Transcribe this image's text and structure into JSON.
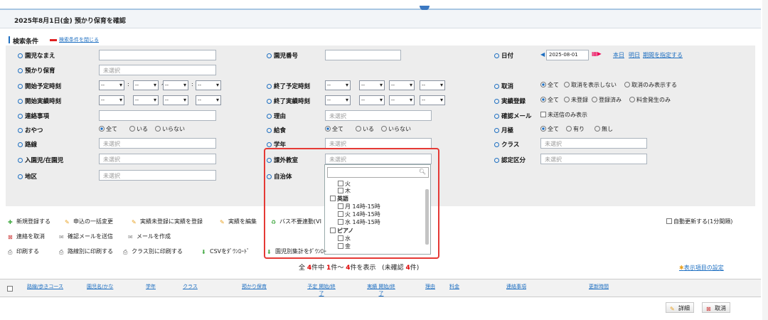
{
  "header": {
    "title": "2025年8月1日(金)  預かり保育を確認"
  },
  "conditions": {
    "title": "検索条件",
    "close_link": "検索条件を閉じる"
  },
  "fields": {
    "child_name": "園児なまえ",
    "child_number": "園児番号",
    "date": "日付",
    "date_value": "2025-08-01",
    "today": "本日",
    "tomorrow": "明日",
    "specify_period": "期間を指定する",
    "care": "預かり保育",
    "unselected": "未選択",
    "start_plan": "開始予定時刻",
    "end_plan": "終了予定時刻",
    "cancel": "取消",
    "cancel_opts": [
      "全て",
      "取消を表示しない",
      "取消のみ表示する"
    ],
    "start_actual": "開始実績時刻",
    "end_actual": "終了実績時刻",
    "actual_reg": "実績登録",
    "actual_opts": [
      "全て",
      "未登録",
      "登録済み",
      "料金発生のみ"
    ],
    "contact": "連絡事項",
    "reason": "理由",
    "confirm_mail": "確認メール",
    "unsent_only": "未送信のみ表示",
    "snack": "おやつ",
    "snack_opts": [
      "全て",
      "いる",
      "いらない"
    ],
    "lunch": "給食",
    "lunch_opts": [
      "全て",
      "いる",
      "いらない"
    ],
    "month_fee": "月極",
    "month_opts": [
      "全て",
      "有り",
      "無し"
    ],
    "route": "路線",
    "grade": "学年",
    "class": "クラス",
    "enroll": "入園児/在園児",
    "extra_class": "課外教室",
    "cert": "認定区分",
    "area": "地区",
    "municipality": "自治体",
    "time_dash": "--"
  },
  "dropdown": {
    "items": [
      "火",
      "木",
      "英語",
      "月  14時-15時",
      "火  14時-15時",
      "水  14時-15時",
      "ピアノ",
      "水",
      "金"
    ]
  },
  "buttons": {
    "new": "新規登録する",
    "bulk": "申込の一括変更",
    "register_actual": "実績未登録に実績を登録",
    "edit_actual": "実績を編集",
    "bus": "バス不要連動(VI",
    "cancel_contact": "連絡を取消",
    "send_confirm": "確認メールを送信",
    "create_mail": "メールを作成",
    "print": "印刷する",
    "print_route": "路線別に印刷する",
    "print_class": "クラス別に印刷する",
    "csv": "CSVをﾀﾞｳﾝﾛｰﾄﾞ",
    "per_child": "園児別集計をﾀﾞｳﾝﾛｰ",
    "auto_update": "自動更新する(1分間隔)",
    "display_settings": "表示項目の設定"
  },
  "summary": {
    "prefix": "全",
    "total": "4",
    "mid": "件中",
    "from": "1",
    "tilde": "件～",
    "to": "4",
    "suffix": "件を表示",
    "unconfirmed_prefix": "(未確認",
    "unconfirmed": "4",
    "unconfirmed_suffix": "件)"
  },
  "table": {
    "headers": [
      "路線/歩きコース",
      "園児名/かな",
      "学年",
      "クラス",
      "預かり保育",
      "予定 開始/終了",
      "実績 開始/終了",
      "理由",
      "料金",
      "連絡事項",
      "更新時間"
    ],
    "detail": "詳細",
    "cancel": "取消"
  }
}
